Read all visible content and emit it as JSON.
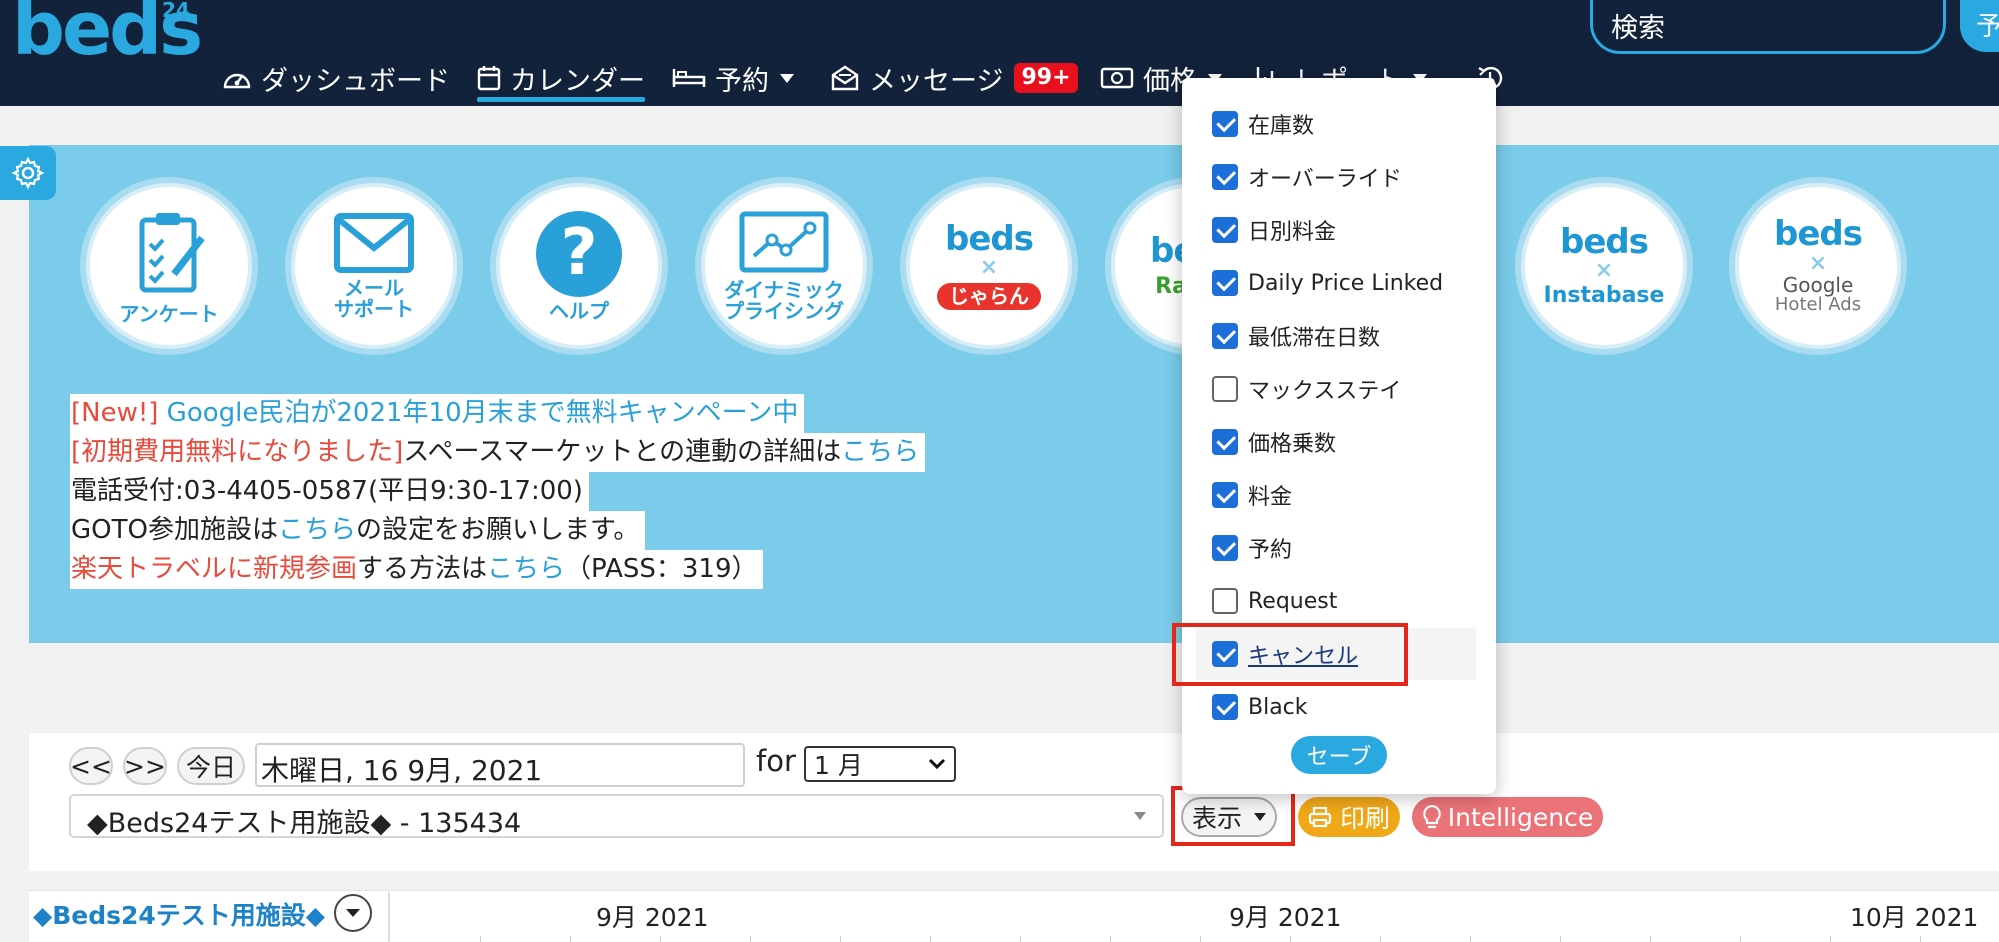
{
  "header": {
    "logo_text": "beds",
    "logo_sup": "24",
    "nav": [
      {
        "label": "ダッシュボード"
      },
      {
        "label": "カレンダー"
      },
      {
        "label": "予約"
      },
      {
        "label": "メッセージ",
        "badge": "99+"
      },
      {
        "label": "価格"
      },
      {
        "label": "レポート"
      }
    ],
    "search_placeholder": "検索",
    "search_btn": "予"
  },
  "banner": {
    "circles": [
      {
        "label": "アンケート"
      },
      {
        "label": "メール\nサポート"
      },
      {
        "label": "ヘルプ"
      },
      {
        "label": "ダイナミック\nプライシング"
      },
      {
        "beds": "beds",
        "x": "×",
        "partner": "じゃらん"
      },
      {
        "beds": "beds",
        "partner": "Ra Tra"
      },
      {
        "beds": "beds",
        "x": "×",
        "partner": "Instabase"
      },
      {
        "beds": "beds",
        "x": "×",
        "partner": "Google",
        "partner2": "Hotel Ads"
      }
    ],
    "notices": [
      {
        "red": "[New!]",
        "link": " Google民泊が2021年10月末まで無料キャンペーン中"
      },
      {
        "red": "[初期費用無料になりました]",
        "text": "スペースマーケットとの連動の詳細は",
        "link": "こちら"
      },
      {
        "text": "電話受付:03-4405-0587(平日9:30-17:00)"
      },
      {
        "text": "GOTO参加施設は",
        "link": "こちら",
        "text2": "の設定をお願いします。"
      },
      {
        "red": "楽天トラベルに新規参画",
        "text": "する方法は",
        "link": "こちら",
        "text2": "（PASS：319）"
      }
    ]
  },
  "controls": {
    "prev": "<<",
    "next": ">>",
    "today": "今日",
    "date_value": "木曜日, 16 9月, 2021",
    "for_label": "for",
    "month_value": "1 月",
    "property_value": "◆Beds24テスト用施設◆ - 135434",
    "display_btn": "表示",
    "print_btn": "印刷",
    "intel_btn": "Intelligence"
  },
  "calendar": {
    "property": "◆Beds24テスト用施設◆",
    "months": [
      "9月 2021",
      "9月 2021",
      "10月 2021"
    ]
  },
  "menu": {
    "options": [
      {
        "label": "在庫数",
        "checked": true
      },
      {
        "label": "オーバーライド",
        "checked": true
      },
      {
        "label": "日別料金",
        "checked": true
      },
      {
        "label": "Daily Price Linked",
        "checked": true
      },
      {
        "label": "最低滞在日数",
        "checked": true
      },
      {
        "label": "マックスステイ",
        "checked": false
      },
      {
        "label": "価格乗数",
        "checked": true
      },
      {
        "label": "料金",
        "checked": true
      },
      {
        "label": "予約",
        "checked": true
      },
      {
        "label": "Request",
        "checked": false
      },
      {
        "label": "キャンセル",
        "checked": true
      },
      {
        "label": "Black",
        "checked": true
      }
    ],
    "save": "セーブ"
  },
  "colors": {
    "header_bg": "#13223b",
    "accent": "#2aa8e0",
    "banner_bg": "#7accea",
    "highlight": "#e3271a"
  }
}
